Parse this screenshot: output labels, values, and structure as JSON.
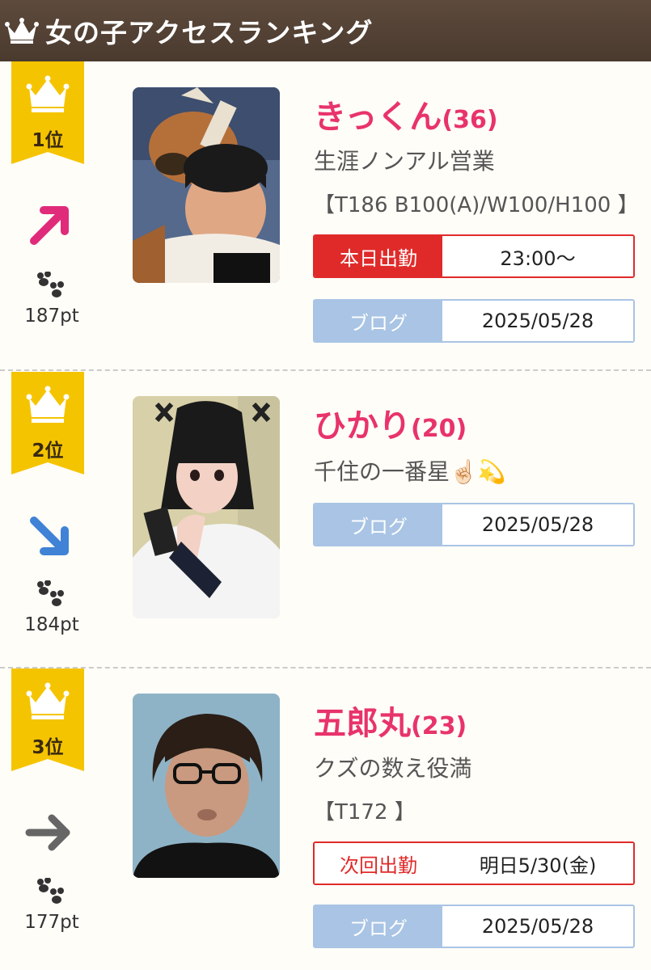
{
  "header": {
    "title": "女の子アクセスランキング",
    "icon": "crown-icon"
  },
  "colors": {
    "accent": "#e8336b",
    "header_bg": "#4f3e31",
    "badge": "#f5c400",
    "work": "#e02a2a",
    "blog": "#a9c4e4"
  },
  "entries": [
    {
      "rank": "1位",
      "trend": "up-right-arrow",
      "points": "187pt",
      "name": "きっくん",
      "age": "(36)",
      "catch": "生涯ノンアル営業",
      "size": "【T186 B100(A)/W100/H100 】",
      "schedule": {
        "label": "本日出勤",
        "value": "23:00〜"
      },
      "blog": {
        "label": "ブログ",
        "value": "2025/05/28"
      }
    },
    {
      "rank": "2位",
      "trend": "down-right-arrow",
      "points": "184pt",
      "name": "ひかり",
      "age": "(20)",
      "catch": "千住の一番星☝🏻💫",
      "blog": {
        "label": "ブログ",
        "value": "2025/05/28"
      }
    },
    {
      "rank": "3位",
      "trend": "right-arrow",
      "points": "177pt",
      "name": "五郎丸",
      "age": "(23)",
      "catch": "クズの数え役満",
      "size": "【T172 】",
      "schedule": {
        "label": "次回出勤",
        "value": "明日5/30(金)"
      },
      "blog": {
        "label": "ブログ",
        "value": "2025/05/28"
      }
    }
  ]
}
